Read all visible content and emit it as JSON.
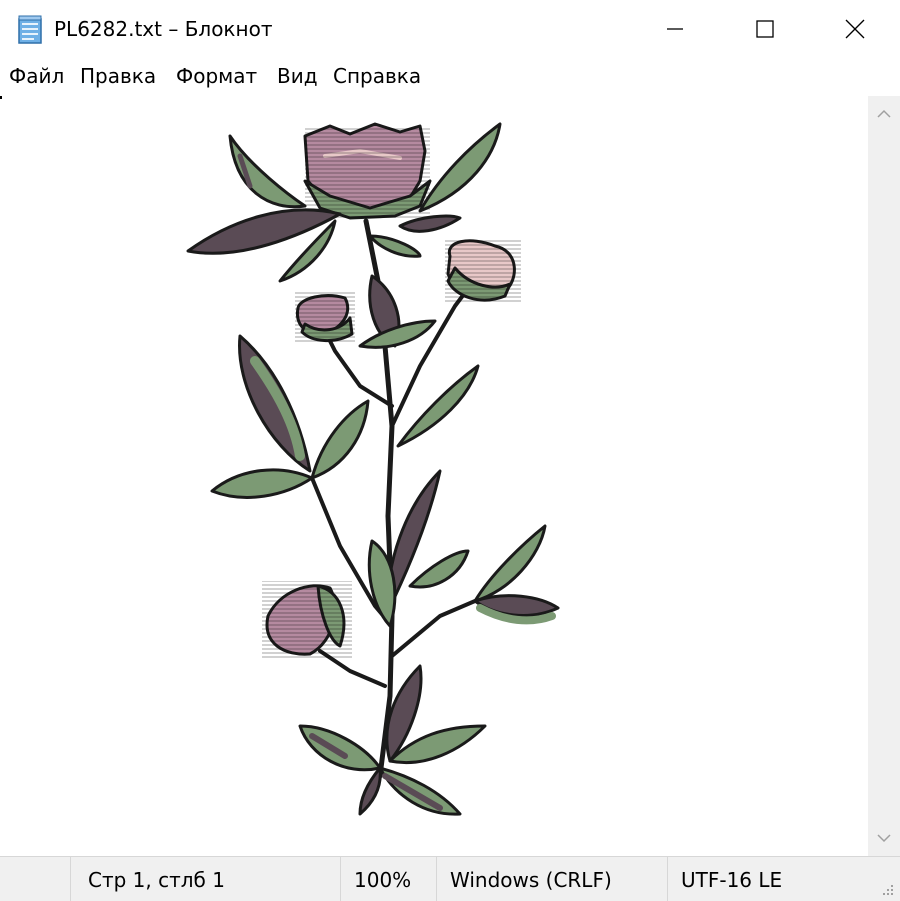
{
  "window": {
    "title": "PL6282.txt – Блокнот",
    "icon": "notepad-icon",
    "controls": [
      "minimize-icon",
      "maximize-icon",
      "close-icon"
    ]
  },
  "menu": {
    "items": [
      "Файл",
      "Правка",
      "Формат",
      "Вид",
      "Справка"
    ]
  },
  "editor": {
    "content": "ascii-art-style rendering of a flowering plant with pink blossoms and green leaves",
    "colors": {
      "petal": "#b58aa0",
      "petal_light": "#e8c8c8",
      "leaf": "#7c9a74",
      "leaf_dark": "#5a4b55",
      "outline": "#1a1a1a",
      "stem": "#5a5a4a"
    }
  },
  "scrollbar": {
    "up": "chevron-up-icon",
    "down": "chevron-down-icon"
  },
  "status": {
    "position": "Стр 1, стлб 1",
    "zoom": "100%",
    "line_endings": "Windows (CRLF)",
    "encoding": "UTF-16 LE"
  }
}
